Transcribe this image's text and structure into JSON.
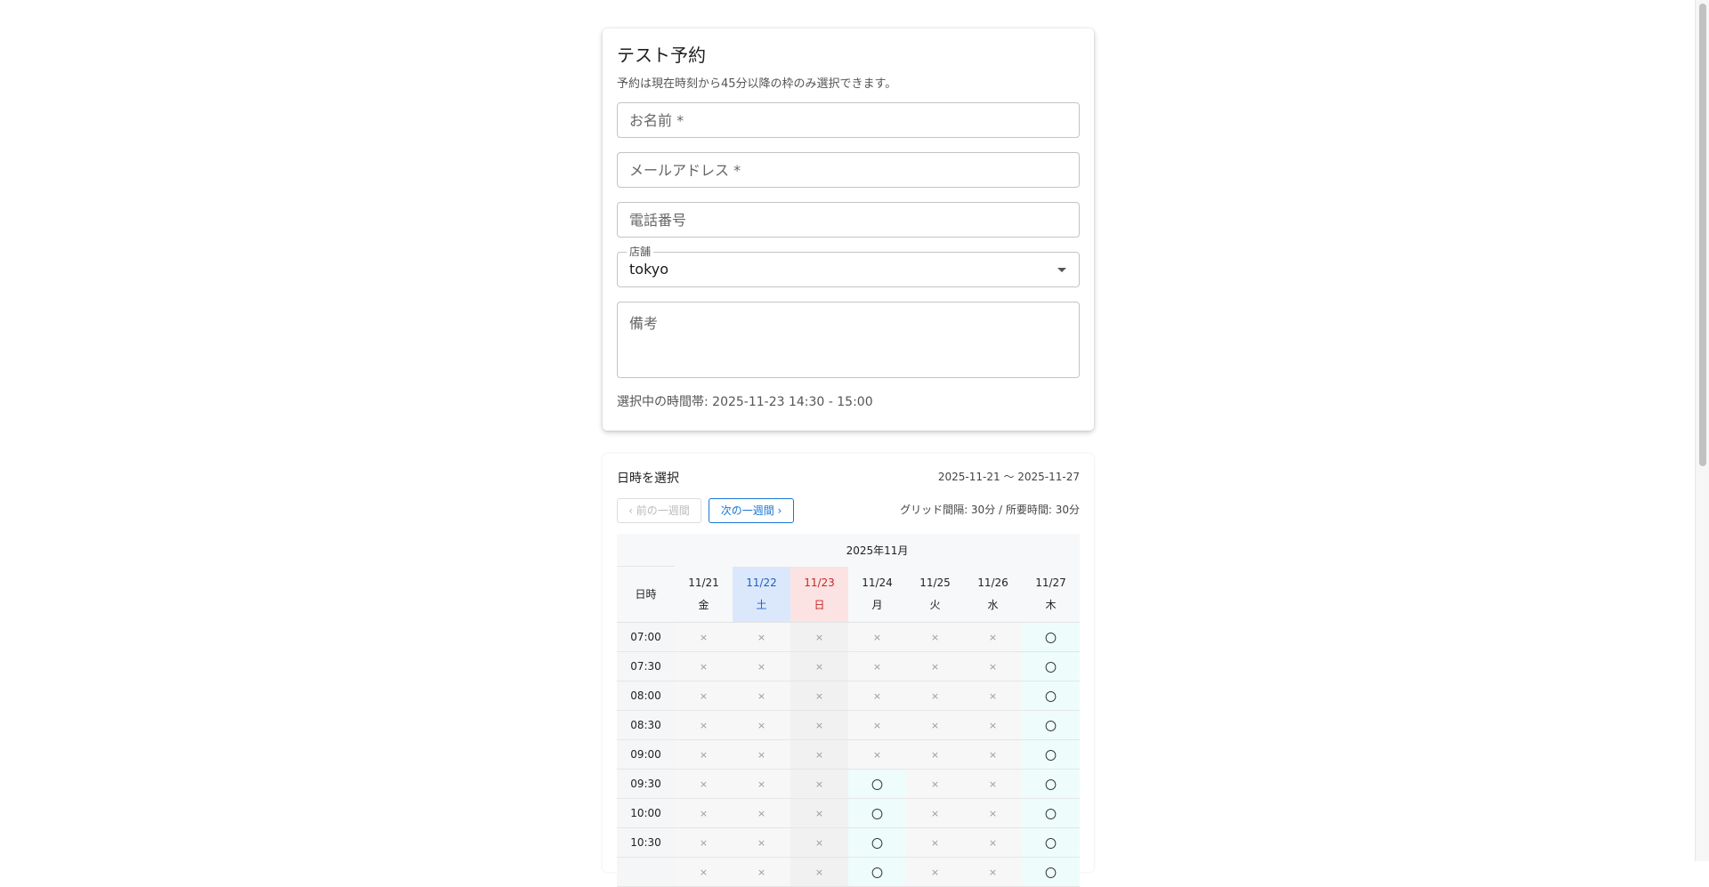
{
  "form": {
    "title": "テスト予約",
    "note": "予約は現在時刻から45分以降の枠のみ選択できます。",
    "name_placeholder": "お名前 *",
    "email_placeholder": "メールアドレス *",
    "phone_placeholder": "電話番号",
    "store_label": "店舗",
    "store_value": "tokyo",
    "remarks_placeholder": "備考",
    "selected_slot": "選択中の時間帯: 2025-11-23 14:30 - 15:00"
  },
  "calendar": {
    "title": "日時を選択",
    "range": "2025-11-21 〜 2025-11-27",
    "prev_label": "‹ 前の一週間",
    "next_label": "次の一週間 ›",
    "grid_info": "グリッド間隔: 30分 / 所要時間: 30分",
    "month": "2025年11月",
    "head_label": "日時",
    "days": [
      {
        "date": "11/21",
        "weekday": "金",
        "kind": "weekday"
      },
      {
        "date": "11/22",
        "weekday": "土",
        "kind": "sat"
      },
      {
        "date": "11/23",
        "weekday": "日",
        "kind": "sun"
      },
      {
        "date": "11/24",
        "weekday": "月",
        "kind": "weekday"
      },
      {
        "date": "11/25",
        "weekday": "火",
        "kind": "weekday"
      },
      {
        "date": "11/26",
        "weekday": "水",
        "kind": "weekday"
      },
      {
        "date": "11/27",
        "weekday": "木",
        "kind": "weekday"
      }
    ],
    "symbols": {
      "available": "〇",
      "unavailable": "×"
    },
    "rows": [
      {
        "time": "07:00",
        "slots": [
          0,
          0,
          0,
          0,
          0,
          0,
          1
        ]
      },
      {
        "time": "07:30",
        "slots": [
          0,
          0,
          0,
          0,
          0,
          0,
          1
        ]
      },
      {
        "time": "08:00",
        "slots": [
          0,
          0,
          0,
          0,
          0,
          0,
          1
        ]
      },
      {
        "time": "08:30",
        "slots": [
          0,
          0,
          0,
          0,
          0,
          0,
          1
        ]
      },
      {
        "time": "09:00",
        "slots": [
          0,
          0,
          0,
          0,
          0,
          0,
          1
        ]
      },
      {
        "time": "09:30",
        "slots": [
          0,
          0,
          0,
          1,
          0,
          0,
          1
        ]
      },
      {
        "time": "10:00",
        "slots": [
          0,
          0,
          0,
          1,
          0,
          0,
          1
        ]
      },
      {
        "time": "10:30",
        "slots": [
          0,
          0,
          0,
          1,
          0,
          0,
          1
        ]
      },
      {
        "time": "",
        "slots": [
          0,
          0,
          0,
          1,
          0,
          0,
          1
        ]
      }
    ]
  }
}
